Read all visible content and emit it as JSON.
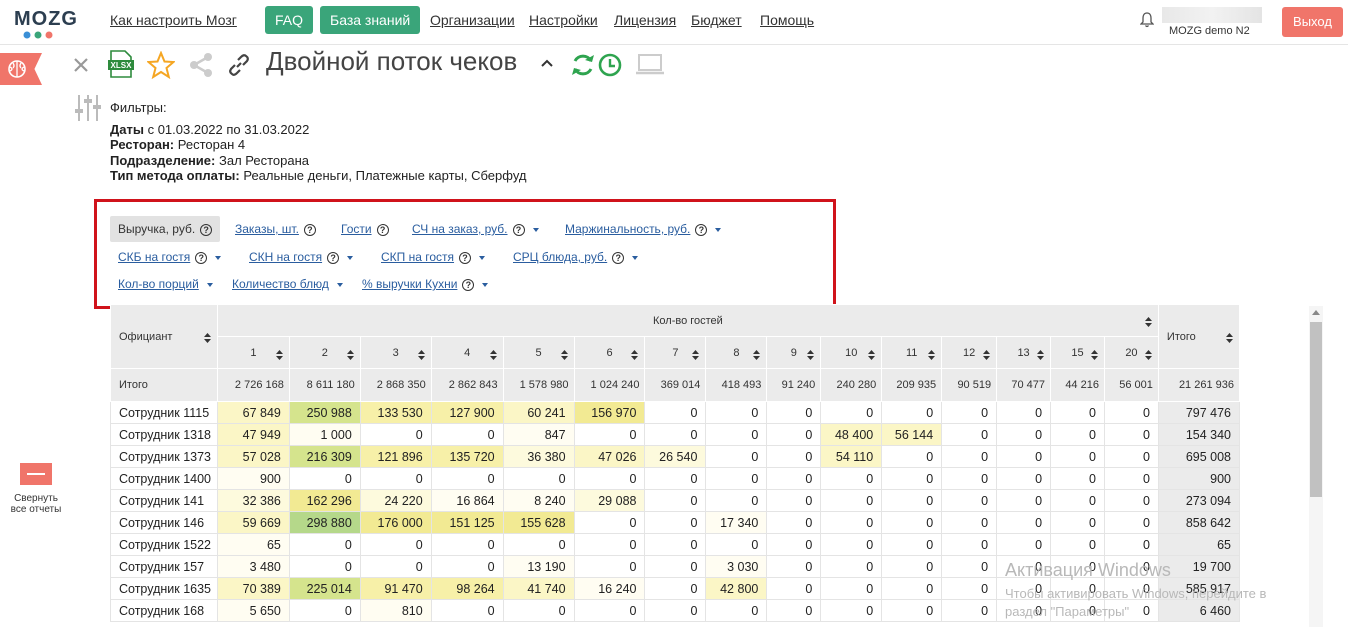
{
  "nav": {
    "logo": "MOZG",
    "links": [
      "Как настроить Мозг",
      "Организации",
      "Настройки",
      "Лицензия",
      "Бюджет",
      "Помощь"
    ],
    "faq": "FAQ",
    "kb": "База знаний",
    "user": "MOZG demo N2",
    "logout": "Выход"
  },
  "report": {
    "title": "Двойной поток чеков"
  },
  "toolbar": {
    "xlsx": "XLSX"
  },
  "filters": {
    "heading": "Фильтры:",
    "dates_label": "Даты",
    "dates_value": "с 01.03.2022 по 31.03.2022",
    "restaurant_label": "Ресторан:",
    "restaurant_value": "Ресторан 4",
    "division_label": "Подразделение:",
    "division_value": "Зал Ресторана",
    "payment_label": "Тип метода оплаты:",
    "payment_value": "Реальные деньги, Платежные карты, Сберфуд"
  },
  "metrics": [
    "Выручка, руб.",
    "Заказы, шт.",
    "Гости",
    "СЧ на заказ, руб.",
    "Маржинальность, руб.",
    "СКБ на гостя",
    "СКН на гостя",
    "СКП на гостя",
    "СРЦ блюда, руб.",
    "Кол-во порций",
    "Количество блюд",
    "% выручки Кухни"
  ],
  "table": {
    "waiter_header": "Официант",
    "group_header": "Кол-во гостей",
    "total_header": "Итого",
    "columns": [
      "1",
      "2",
      "3",
      "4",
      "5",
      "6",
      "7",
      "8",
      "9",
      "10",
      "11",
      "12",
      "13",
      "15",
      "20"
    ],
    "totals_label": "Итого",
    "totals": [
      "2 726 168",
      "8 611 180",
      "2 868 350",
      "2 862 843",
      "1 578 980",
      "1 024 240",
      "369 014",
      "418 493",
      "91 240",
      "240 280",
      "209 935",
      "90 519",
      "70 477",
      "44 216",
      "56 001",
      "21 261 936"
    ],
    "rows": [
      {
        "name": "Сотрудник 1115",
        "v": [
          "67 849",
          "250 988",
          "133 530",
          "127 900",
          "60 241",
          "156 970",
          "0",
          "0",
          "0",
          "0",
          "0",
          "0",
          "0",
          "0",
          "0"
        ],
        "total": "797 476"
      },
      {
        "name": "Сотрудник 1318",
        "v": [
          "47 949",
          "1 000",
          "0",
          "0",
          "847",
          "0",
          "0",
          "0",
          "0",
          "48 400",
          "56 144",
          "0",
          "0",
          "0",
          "0"
        ],
        "total": "154 340"
      },
      {
        "name": "Сотрудник 1373",
        "v": [
          "57 028",
          "216 309",
          "121 896",
          "135 720",
          "36 380",
          "47 026",
          "26 540",
          "0",
          "0",
          "54 110",
          "0",
          "0",
          "0",
          "0",
          "0"
        ],
        "total": "695 008"
      },
      {
        "name": "Сотрудник 1400",
        "v": [
          "900",
          "0",
          "0",
          "0",
          "0",
          "0",
          "0",
          "0",
          "0",
          "0",
          "0",
          "0",
          "0",
          "0",
          "0"
        ],
        "total": "900"
      },
      {
        "name": "Сотрудник 141",
        "v": [
          "32 386",
          "162 296",
          "24 220",
          "16 864",
          "8 240",
          "29 088",
          "0",
          "0",
          "0",
          "0",
          "0",
          "0",
          "0",
          "0",
          "0"
        ],
        "total": "273 094"
      },
      {
        "name": "Сотрудник 146",
        "v": [
          "59 669",
          "298 880",
          "176 000",
          "151 125",
          "155 628",
          "0",
          "0",
          "17 340",
          "0",
          "0",
          "0",
          "0",
          "0",
          "0",
          "0"
        ],
        "total": "858 642"
      },
      {
        "name": "Сотрудник 1522",
        "v": [
          "65",
          "0",
          "0",
          "0",
          "0",
          "0",
          "0",
          "0",
          "0",
          "0",
          "0",
          "0",
          "0",
          "0",
          "0"
        ],
        "total": "65"
      },
      {
        "name": "Сотрудник 157",
        "v": [
          "3 480",
          "0",
          "0",
          "0",
          "13 190",
          "0",
          "0",
          "3 030",
          "0",
          "0",
          "0",
          "0",
          "0",
          "0",
          "0"
        ],
        "total": "19 700"
      },
      {
        "name": "Сотрудник 1635",
        "v": [
          "70 389",
          "225 014",
          "91 470",
          "98 264",
          "41 740",
          "16 240",
          "0",
          "42 800",
          "0",
          "0",
          "0",
          "0",
          "0",
          "0",
          "0"
        ],
        "total": "585 917"
      },
      {
        "name": "Сотрудник 168",
        "v": [
          "5 650",
          "0",
          "810",
          "0",
          "0",
          "0",
          "0",
          "0",
          "0",
          "0",
          "0",
          "0",
          "0",
          "0",
          "0"
        ],
        "total": "6 460"
      }
    ]
  },
  "collapse_label_1": "Свернуть",
  "collapse_label_2": "все отчеты",
  "watermark": {
    "line1": "Активация Windows",
    "line2": "Чтобы активировать Windows, перейдите в",
    "line3": "раздел \"Параметры\""
  },
  "colors": {
    "accent": "#3aa57a",
    "logout": "#f0756a",
    "highlight_border": "#d0131b",
    "link": "#2a5d9f"
  }
}
